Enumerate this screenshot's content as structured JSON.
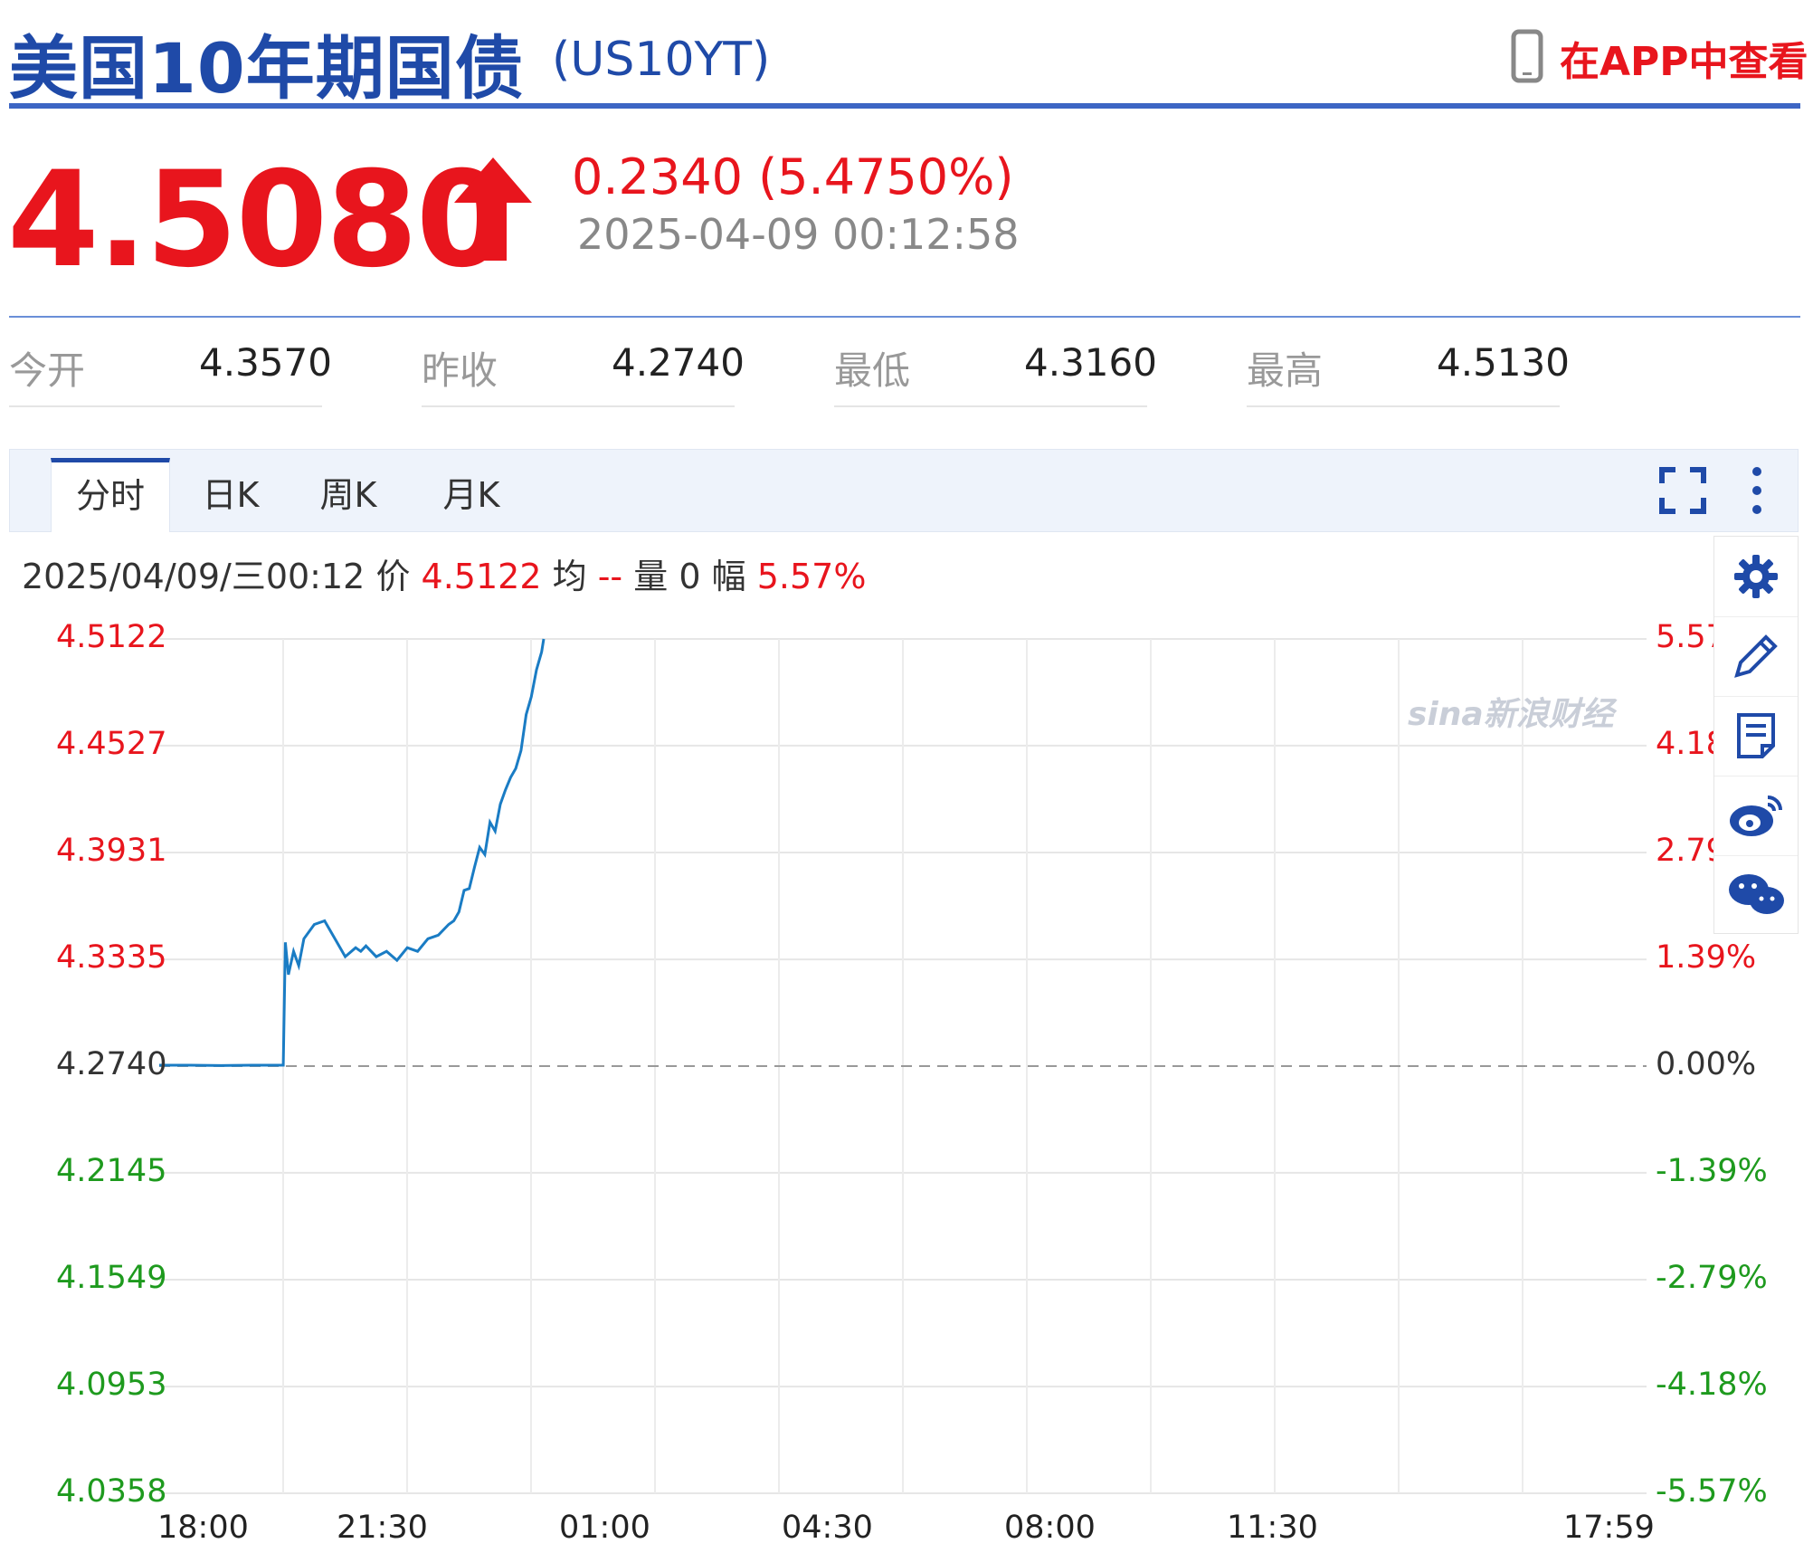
{
  "header": {
    "title": "美国10年期国债",
    "code": "(US10YT)",
    "app_link_label": "在APP中查看"
  },
  "quote": {
    "price": "4.5080",
    "direction": "up",
    "change": "0.2340 (5.4750%)",
    "timestamp": "2025-04-09 00:12:58"
  },
  "stats": [
    {
      "label": "今开",
      "value": "4.3570"
    },
    {
      "label": "昨收",
      "value": "4.2740"
    },
    {
      "label": "最低",
      "value": "4.3160"
    },
    {
      "label": "最高",
      "value": "4.5130"
    }
  ],
  "tabs": [
    {
      "label": "分时",
      "active": true
    },
    {
      "label": "日K",
      "active": false
    },
    {
      "label": "周K",
      "active": false
    },
    {
      "label": "月K",
      "active": false
    }
  ],
  "toolbar_icons": [
    "fullscreen-icon",
    "more-vertical-icon"
  ],
  "sidebar_icons": [
    "gear-icon",
    "pencil-icon",
    "note-icon",
    "weibo-icon",
    "wechat-icon"
  ],
  "info_line": {
    "datetime": "2025/04/09/三00:12",
    "price_label": "价",
    "price": "4.5122",
    "avg_label": "均",
    "avg": "--",
    "vol_label": "量",
    "vol": "0",
    "amp_label": "幅",
    "amp": "5.57%"
  },
  "watermark": "sina新浪财经",
  "colors": {
    "up": "#e8151d",
    "down": "#1e9a1e",
    "line": "#1a7cc4",
    "brand": "#1f4aa8"
  },
  "chart_data": {
    "type": "line",
    "base_price": 4.274,
    "y_left_ticks": [
      "4.5122",
      "4.4527",
      "4.3931",
      "4.3335",
      "4.2740",
      "4.2145",
      "4.1549",
      "4.0953",
      "4.0358"
    ],
    "y_right_ticks": [
      "5.57",
      "4.18",
      "2.79",
      "1.39%",
      "0.00%",
      "-1.39%",
      "-2.79%",
      "-4.18%",
      "-5.57%"
    ],
    "ylim": [
      4.0358,
      4.5122
    ],
    "x_ticks": [
      "18:00",
      "21:30",
      "01:00",
      "04:30",
      "08:00",
      "11:30",
      "17:59"
    ],
    "x_range": [
      "18:00",
      "17:59"
    ],
    "grid": true,
    "series": [
      {
        "x": [
          "18:00",
          "18:30",
          "19:00",
          "19:30",
          "19:55",
          "20:00",
          "20:02",
          "20:05",
          "20:10",
          "20:15",
          "20:20",
          "20:30",
          "20:40",
          "20:50",
          "21:00",
          "21:10",
          "21:15",
          "21:20",
          "21:30",
          "21:40",
          "21:50",
          "22:00",
          "22:10",
          "22:20",
          "22:30",
          "22:40",
          "22:45",
          "22:50",
          "22:55",
          "23:00",
          "23:05",
          "23:10",
          "23:15",
          "23:20",
          "23:25",
          "23:30",
          "23:35",
          "23:40",
          "23:45",
          "23:50",
          "23:55",
          "24:00",
          "00:05",
          "00:10",
          "00:12"
        ],
        "y": [
          4.2745,
          4.2745,
          4.2743,
          4.2745,
          4.2745,
          4.2745,
          4.343,
          4.325,
          4.338,
          4.33,
          4.345,
          4.353,
          4.355,
          4.345,
          4.335,
          4.34,
          4.338,
          4.341,
          4.335,
          4.338,
          4.333,
          4.34,
          4.338,
          4.345,
          4.347,
          4.353,
          4.355,
          4.36,
          4.372,
          4.373,
          4.385,
          4.396,
          4.392,
          4.41,
          4.405,
          4.42,
          4.428,
          4.435,
          4.44,
          4.45,
          4.47,
          4.48,
          4.495,
          4.505,
          4.5122
        ]
      }
    ]
  }
}
